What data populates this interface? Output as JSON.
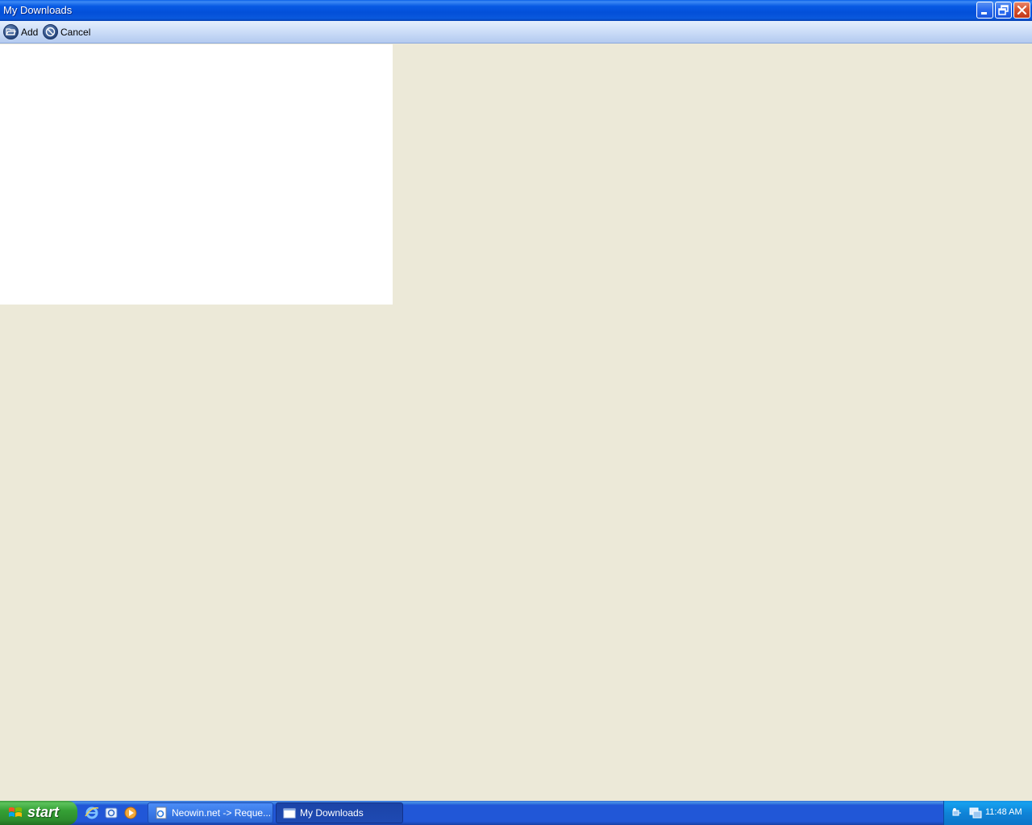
{
  "window": {
    "title": "My Downloads",
    "controls": {
      "minimize": "minimize",
      "maximize": "restore",
      "close": "close"
    }
  },
  "toolbar": {
    "add_label": "Add",
    "cancel_label": "Cancel"
  },
  "taskbar": {
    "start_label": "start",
    "quick_launch": [
      "internet-explorer-icon",
      "outlook-express-icon",
      "media-player-icon"
    ],
    "tasks": [
      {
        "label": "Neowin.net -> Reque...",
        "icon": "browser-page-icon",
        "active": false
      },
      {
        "label": "My Downloads",
        "icon": "window-app-icon",
        "active": true
      }
    ],
    "clock": "11:48 AM"
  },
  "colors": {
    "title_bar": "#0350d9",
    "workspace": "#ece9d8",
    "taskbar": "#2157d7",
    "start": "#35a035",
    "tray": "#0f84d8"
  }
}
